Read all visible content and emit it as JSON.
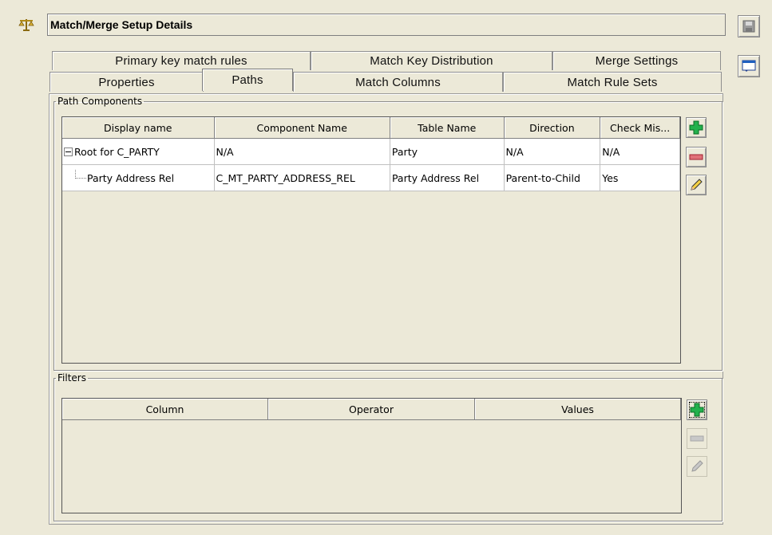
{
  "header": {
    "title": "Match/Merge Setup Details",
    "icon": "scales-icon"
  },
  "side_buttons": [
    {
      "name": "save",
      "icon": "floppy-disk-icon"
    },
    {
      "name": "window",
      "icon": "window-icon"
    }
  ],
  "tabs": {
    "row1": [
      "Primary key match rules",
      "Match Key Distribution",
      "Merge Settings"
    ],
    "row2": [
      "Properties",
      "Paths",
      "Match Columns",
      "Match Rule Sets"
    ],
    "active": "Paths"
  },
  "path_components": {
    "label": "Path Components",
    "columns": [
      "Display name",
      "Component Name",
      "Table Name",
      "Direction",
      "Check Mis..."
    ],
    "rows": [
      {
        "display_name": "Root for C_PARTY",
        "component_name": "N/A",
        "table_name": "Party",
        "direction": "N/A",
        "check_missing": "N/A"
      },
      {
        "display_name": "Party Address Rel",
        "component_name": "C_MT_PARTY_ADDRESS_REL",
        "table_name": "Party Address Rel",
        "direction": "Parent-to-Child",
        "check_missing": "Yes"
      }
    ]
  },
  "filters": {
    "label": "Filters",
    "columns": [
      "Column",
      "Operator",
      "Values"
    ]
  },
  "colors": {
    "background": "#ece9d8",
    "add": "#22b14c",
    "remove": "#e07078"
  }
}
